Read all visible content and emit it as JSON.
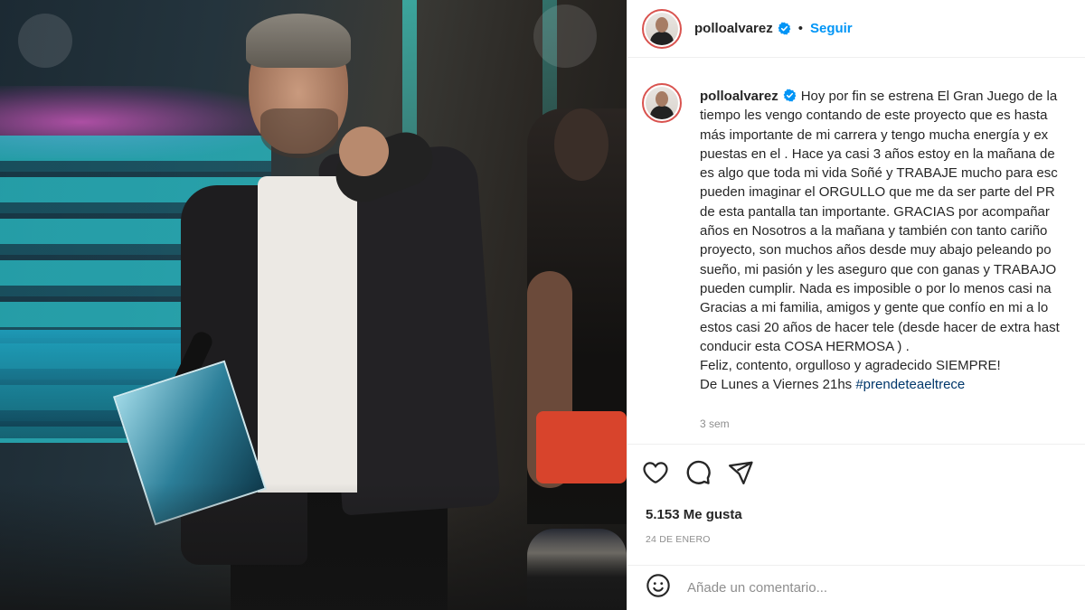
{
  "header": {
    "username": "polloalvarez",
    "separator": "•",
    "follow_label": "Seguir"
  },
  "caption": {
    "username": "polloalvarez",
    "lines": [
      "Hoy por fin se estrena El Gran Juego de la",
      "tiempo les vengo contando de este proyecto que es hasta",
      "más importante de mi carrera y tengo mucha energía y ex",
      "puestas en el . Hace ya casi 3 años estoy en la mañana de",
      "es algo que toda mi vida Soñé y TRABAJE mucho para esc",
      "pueden imaginar el ORGULLO que me da ser parte del PR",
      "de esta pantalla tan importante. GRACIAS por acompañar",
      "años en Nosotros a la mañana y también con tanto cariño",
      "proyecto, son muchos años desde muy abajo peleando po",
      "sueño, mi pasión y les aseguro que con ganas y TRABAJO",
      "pueden cumplir. Nada es imposible o por lo menos casi na",
      "Gracias a mi familia, amigos y gente que confío en mi a lo",
      "estos casi 20 años de hacer tele (desde hacer de extra hast",
      "conducir esta COSA HERMOSA ) .",
      "Feliz, contento, orgulloso y agradecido SIEMPRE!"
    ],
    "last_line_prefix": "De Lunes a Viernes 21hs ",
    "hashtag": "#prendeteaeltrece",
    "time_ago": "3 sem"
  },
  "engagement": {
    "likes": "5.153 Me gusta",
    "date": "24 DE ENERO"
  },
  "comment": {
    "placeholder": "Añade un comentario..."
  },
  "icons": [
    "heart-icon",
    "comment-icon",
    "share-icon",
    "emoji-icon",
    "verified-badge-icon"
  ],
  "colors": {
    "accent": "#0095f6",
    "verified": "#0095f6",
    "hashtag": "#00376b",
    "muted": "#8e8e8e"
  }
}
